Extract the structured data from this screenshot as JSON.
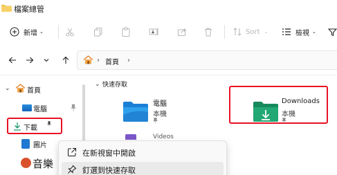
{
  "window": {
    "title": "檔案總管",
    "icon": "folder-icon"
  },
  "toolbar": {
    "new_label": "新增",
    "new_icon": "plus-circle-icon",
    "cut_icon": "scissors-icon",
    "copy_icon": "copy-icon",
    "paste_icon": "clipboard-icon",
    "rename_icon": "rename-icon",
    "share_icon": "share-icon",
    "delete_icon": "trash-icon",
    "sort_label": "Sort",
    "sort_icon": "sort-arrows-icon",
    "view_label": "檢視",
    "view_icon": "view-list-icon",
    "filter_icon": "filter-icon"
  },
  "navigation": {
    "back_icon": "arrow-left-icon",
    "forward_icon": "arrow-right-icon",
    "history_icon": "chevron-down-icon",
    "up_icon": "arrow-up-icon",
    "breadcrumb_home": "首頁",
    "breadcrumb_separator": "›"
  },
  "sidebar": {
    "items": [
      {
        "label": "首頁",
        "icon": "home-icon",
        "expanded": true
      },
      {
        "label": "電腦",
        "icon": "desktop-folder-icon",
        "pinned": true
      },
      {
        "label": "下載",
        "icon": "download-icon",
        "pinned": true
      },
      {
        "label": "圖片",
        "icon": "pictures-icon"
      },
      {
        "label": "音樂",
        "icon": "music-icon"
      }
    ]
  },
  "main": {
    "section_label": "快速存取",
    "tiles": [
      {
        "name": "電腦",
        "sub": "本機",
        "icon": "desktop-folder-icon",
        "pinned": true
      },
      {
        "name": "Downloads",
        "sub": "本機",
        "icon": "downloads-folder-icon",
        "pinned": true
      },
      {
        "name": "Videos",
        "icon": "videos-folder-icon"
      }
    ]
  },
  "context_menu": {
    "items": [
      {
        "label": "在新視窗中開啟",
        "icon": "open-new-window-icon"
      },
      {
        "label": "釘選到快速存取",
        "icon": "pin-icon",
        "hovered": true
      }
    ]
  },
  "colors": {
    "accent": "#0067c0",
    "highlight_border": "#e81123",
    "folder_blue": "#1f8fe0",
    "folder_green": "#1e9e6a"
  }
}
